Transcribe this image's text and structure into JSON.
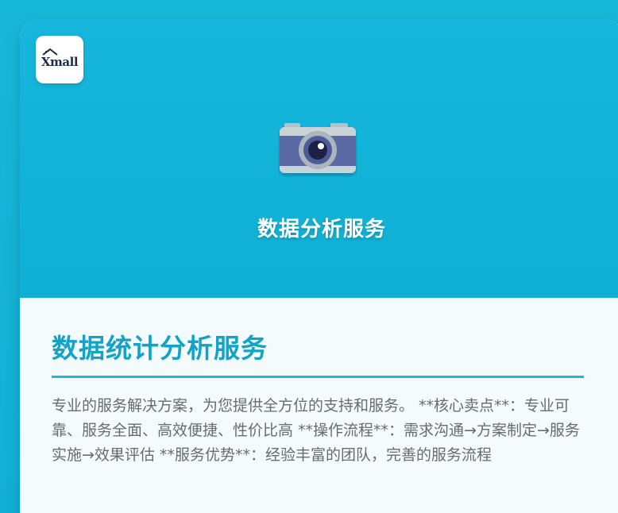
{
  "logo": {
    "text": "Xmall"
  },
  "hero": {
    "icon": "camera-icon",
    "title": "数据分析服务"
  },
  "content": {
    "title": "数据统计分析服务",
    "description": "专业的服务解决方案，为您提供全方位的支持和服务。 **核心卖点**：专业可靠、服务全面、高效便捷、性价比高 **操作流程**：需求沟通→方案制定→服务实施→效果评估 **服务优势**：经验丰富的团队，完善的服务流程"
  },
  "colors": {
    "page_background": "#14b3d6",
    "hero_background": "#17b6dc",
    "accent": "#12a3c7",
    "divider": "#22b6d9",
    "body_text": "#666c72",
    "content_background": "#f3fbfc"
  }
}
